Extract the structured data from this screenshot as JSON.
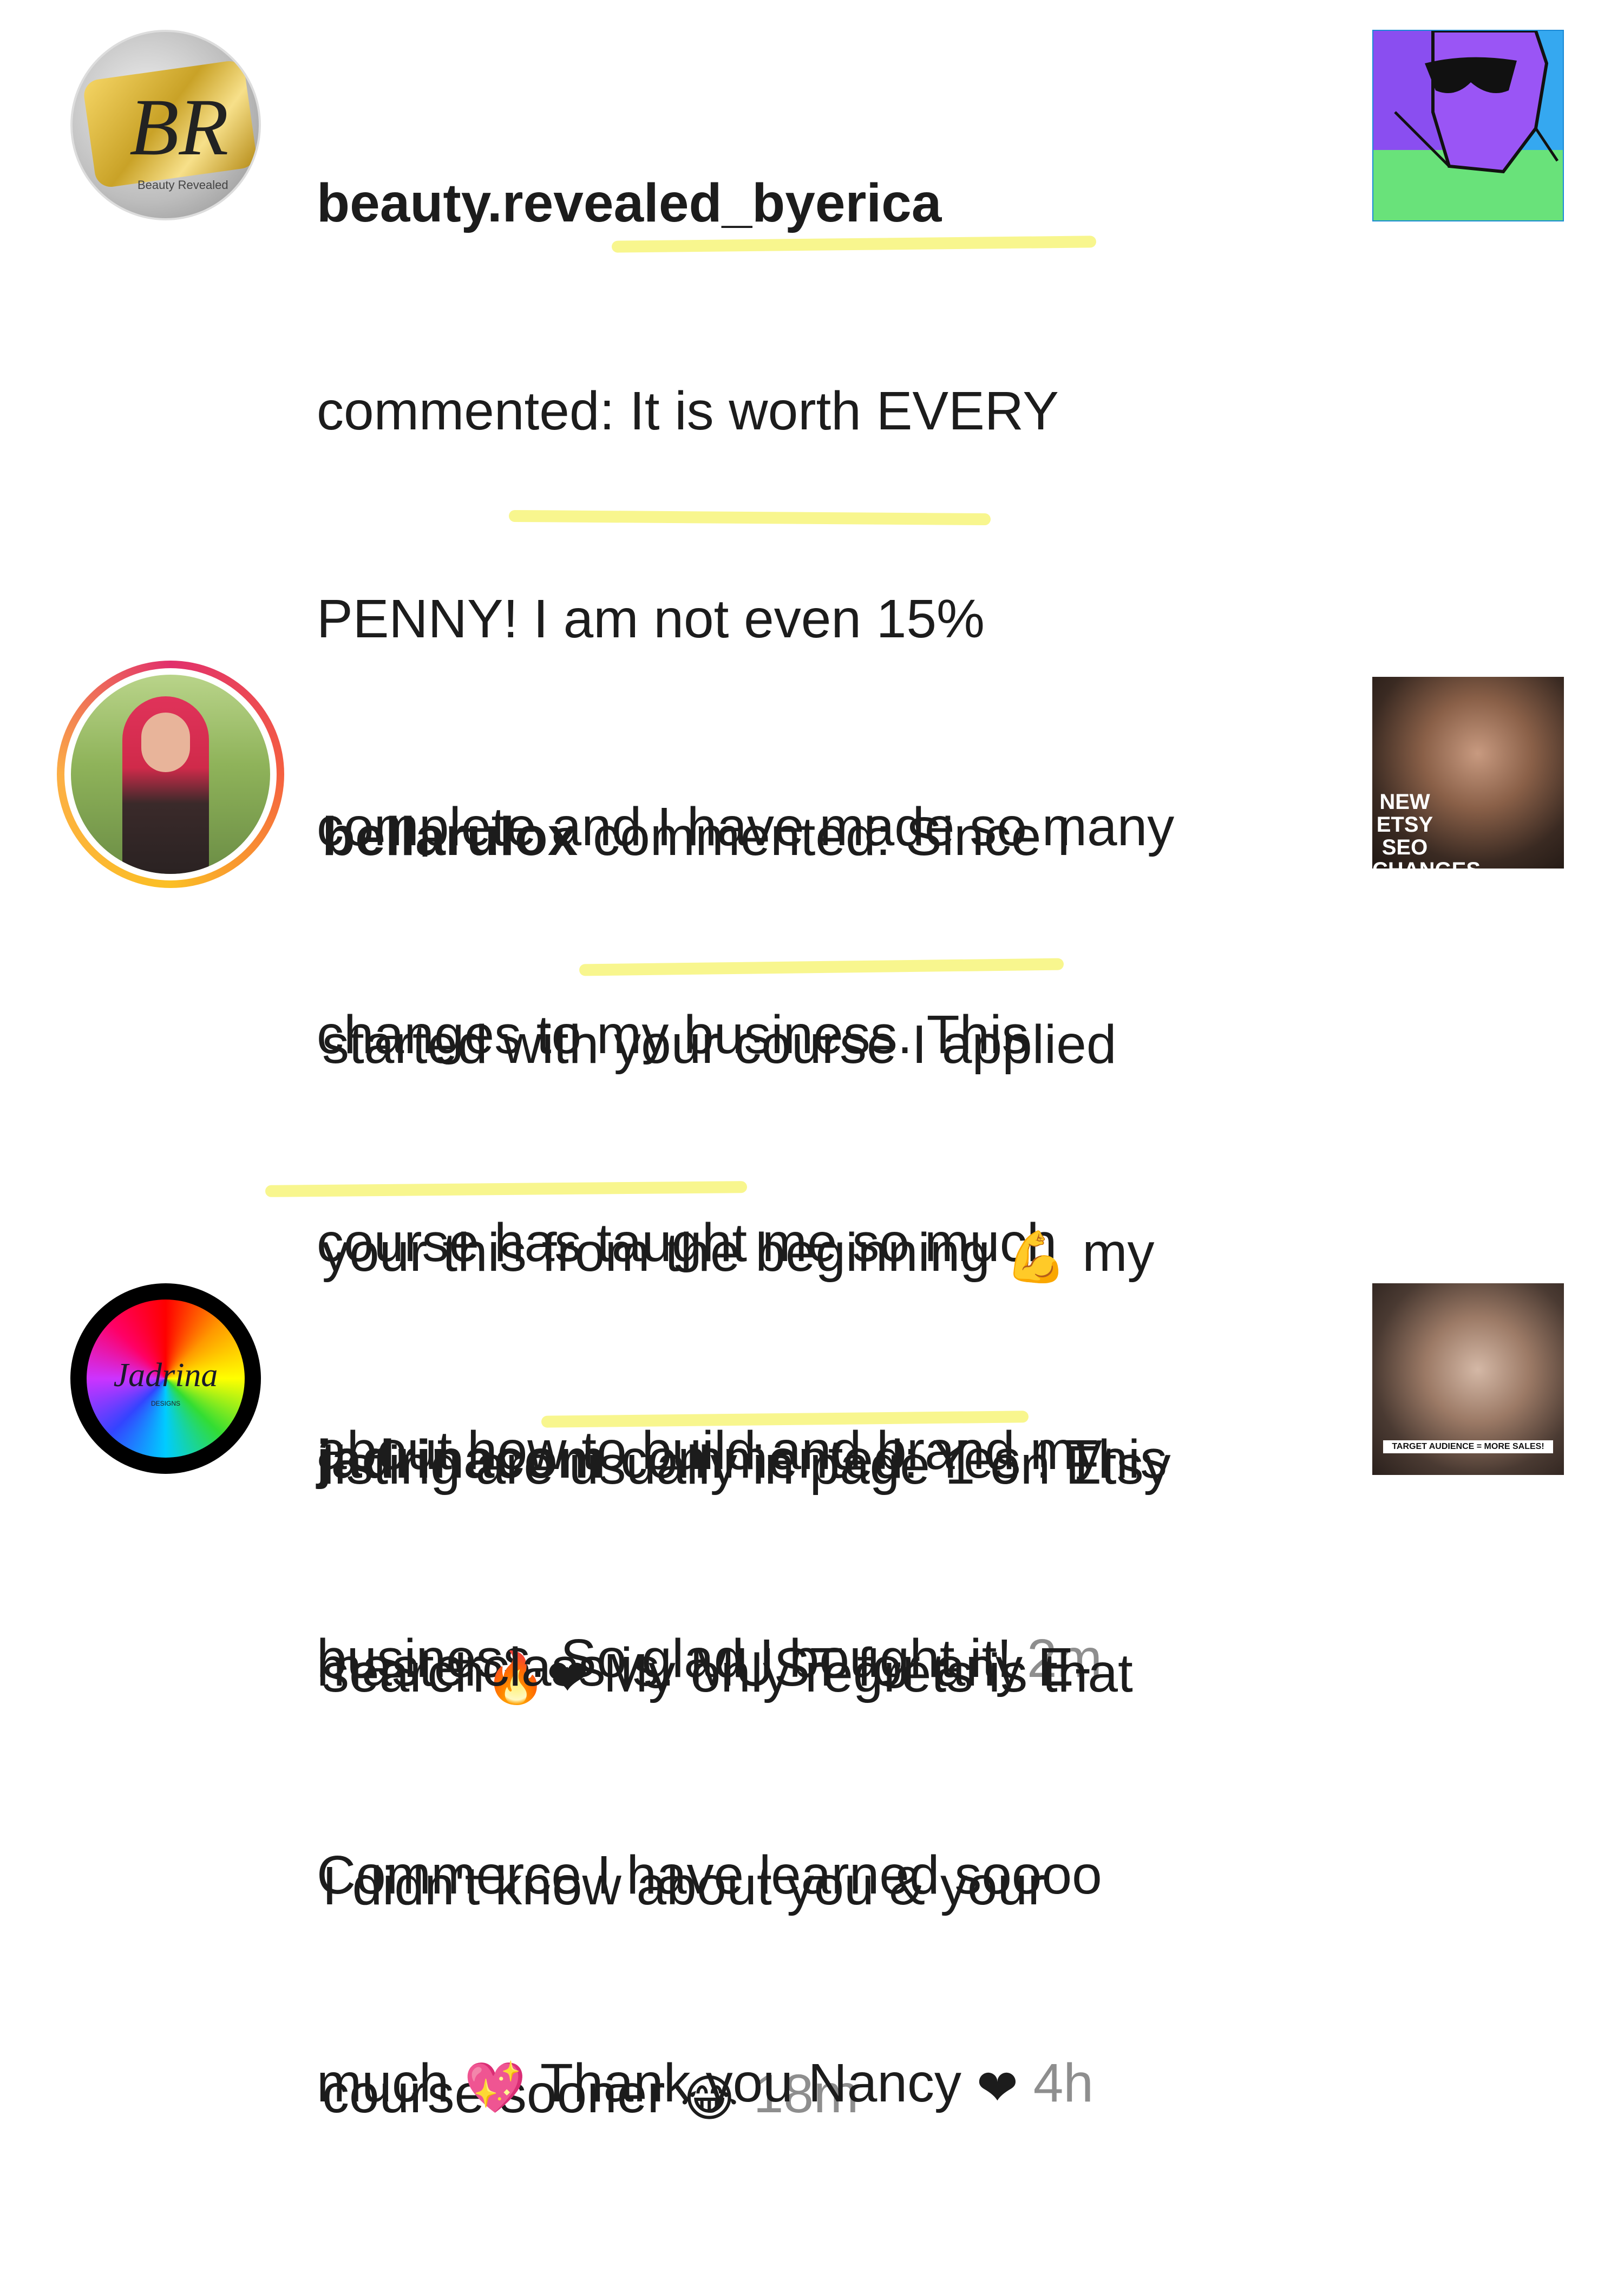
{
  "comments": [
    {
      "username": "beauty.revealed_byerica",
      "lines": [
        "commented: It is worth EVERY",
        "PENNY! I am not even 15%",
        "complete and I have made so many",
        "changes to my business. This",
        "course has taught me so much",
        "about how to build and brand my",
        "business. So glad I bought it!"
      ],
      "time": "2m",
      "avatar_initials": "BR",
      "avatar_caption": "Beauty Revealed"
    },
    {
      "username": "bellarulox",
      "lines": [
        " commented: Since I",
        "started with your course I applied",
        "your this from the beginning",
        "listing are usually in page 1 on Etsy",
        "search",
        "I didn't know about you & your",
        "course sooner"
      ],
      "muscle_text": " my",
      "search_tail": " My only regrets is that",
      "time": "18m",
      "thumb_caption_1": "NEW",
      "thumb_caption_2": "ETSY SEO",
      "thumb_caption_3": "CHANGES"
    },
    {
      "username": "jadrinacom",
      "lines": [
        " commented: Yes ! This",
        "masterclass is. MUST for any E-",
        "Commerce I have learned soooo",
        "much"
      ],
      "thanks": " Thank you Nancy",
      "time": "4h",
      "avatar_logo": "Jadrina",
      "avatar_sub": "DESIGNS",
      "thumb_caption": "TARGET AUDIENCE = MORE SALES!"
    }
  ],
  "colors": {
    "highlight": "#f7f47a",
    "timestamp": "#8e8e8e",
    "story_ring_start": "#fbbf24",
    "story_ring_end": "#e1306c"
  },
  "icons": [
    "flexed-biceps-emoji",
    "fire-emoji",
    "red-heart-emoji",
    "tears-of-joy-emoji",
    "sparkling-heart-emoji"
  ]
}
